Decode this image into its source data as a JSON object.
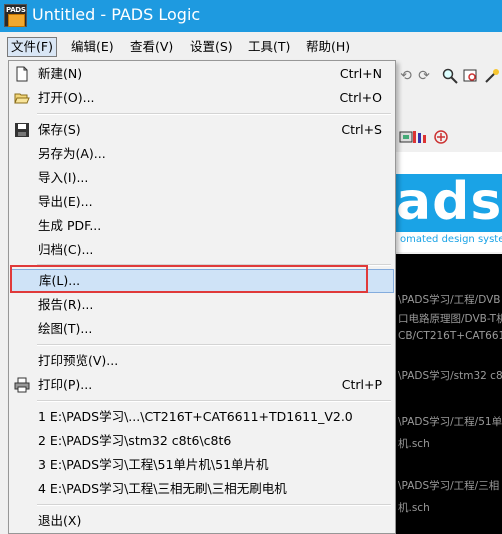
{
  "window": {
    "title": "Untitled - PADS Logic",
    "icon_text": "PADS"
  },
  "menubar": [
    "文件(F)",
    "编辑(E)",
    "查看(V)",
    "设置(S)",
    "工具(T)",
    "帮助(H)"
  ],
  "file_menu": {
    "items": [
      {
        "label": "新建(N)",
        "shortcut": "Ctrl+N",
        "icon": "new-file-icon"
      },
      {
        "label": "打开(O)...",
        "shortcut": "Ctrl+O",
        "icon": "open-folder-icon"
      },
      {
        "label": "保存(S)",
        "shortcut": "Ctrl+S",
        "icon": "save-disk-icon"
      },
      {
        "label": "另存为(A)...",
        "shortcut": ""
      },
      {
        "label": "导入(I)...",
        "shortcut": ""
      },
      {
        "label": "导出(E)...",
        "shortcut": ""
      },
      {
        "label": "生成 PDF...",
        "shortcut": ""
      },
      {
        "label": "归档(C)...",
        "shortcut": ""
      },
      {
        "label": "库(L)...",
        "shortcut": ""
      },
      {
        "label": "报告(R)...",
        "shortcut": ""
      },
      {
        "label": "绘图(T)...",
        "shortcut": ""
      },
      {
        "label": "打印预览(V)...",
        "shortcut": ""
      },
      {
        "label": "打印(P)...",
        "shortcut": "Ctrl+P",
        "icon": "printer-icon"
      },
      {
        "label": "1 E:\\PADS学习\\...\\CT216T+CAT6611+TD1611_V2.0",
        "shortcut": ""
      },
      {
        "label": "2 E:\\PADS学习\\stm32 c8t6\\c8t6",
        "shortcut": ""
      },
      {
        "label": "3 E:\\PADS学习\\工程\\51单片机\\51单片机",
        "shortcut": ""
      },
      {
        "label": "4 E:\\PADS学习\\工程\\三相无刷\\三相无刷电机",
        "shortcut": ""
      },
      {
        "label": "退出(X)",
        "shortcut": ""
      }
    ]
  },
  "logo": {
    "text": "ads",
    "tagline": "omated design system"
  },
  "console_lines": [
    "\\PADS学习/工程/DVB",
    "口电路原理图/DVB-T机",
    "CB/CT216T+CAT6611-",
    "\\PADS学习/stm32 c8t",
    "\\PADS学习/工程/51单",
    "机.sch",
    "\\PADS学习/工程/三相",
    "机.sch"
  ],
  "colors": {
    "titlebar": "#1e9ae0",
    "highlight": "#cfe3f7",
    "annotation": "#e03a3a"
  }
}
